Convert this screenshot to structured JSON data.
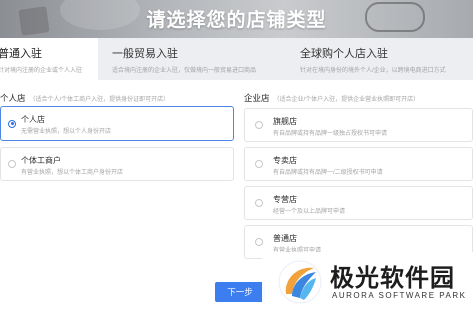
{
  "header": {
    "title": "请选择您的店铺类型"
  },
  "tabs": [
    {
      "label": "普通入驻",
      "desc": "针对境内注册的企业或个人入驻",
      "active": true
    },
    {
      "label": "一般贸易入驻",
      "desc": "适合境内注册的企业入驻，仅做境内一般贸易进口商品",
      "active": false
    },
    {
      "label": "全球购个人店入驻",
      "desc": "针对在境内身份的境外个人/企业，以跨境电商进口方式",
      "active": false
    }
  ],
  "personal": {
    "heading": "个人店",
    "hint": "（适合个人/个体工商户入驻，提供身份证即可开店）",
    "options": [
      {
        "title": "个人店",
        "desc": "无需营业执照，想以个人身份开店",
        "selected": true
      },
      {
        "title": "个体工商户",
        "desc": "有营业执照，想以个体工商户身份开店",
        "selected": false
      }
    ]
  },
  "enterprise": {
    "heading": "企业店",
    "hint": "（适合企业/个体户入驻，提供企业营业执照即可开店）",
    "options": [
      {
        "title": "旗舰店",
        "desc": "有自品牌或持有品牌一级独占授权书可申请",
        "selected": false
      },
      {
        "title": "专卖店",
        "desc": "有自品牌或持有品牌一/二级授权书可申请",
        "selected": false
      },
      {
        "title": "专营店",
        "desc": "经营一个及以上品牌可申请",
        "selected": false
      },
      {
        "title": "普通店",
        "desc": "有营业执照可申请",
        "selected": false
      }
    ]
  },
  "actions": {
    "next_label": "下一步"
  },
  "watermark": {
    "name": "极光软件园",
    "sub": "AURORA SOFTWARE PARK"
  },
  "colors": {
    "accent": "#3c7df0",
    "selected_border": "#4e86e8",
    "tab_bar_bg": "#eceef1"
  }
}
